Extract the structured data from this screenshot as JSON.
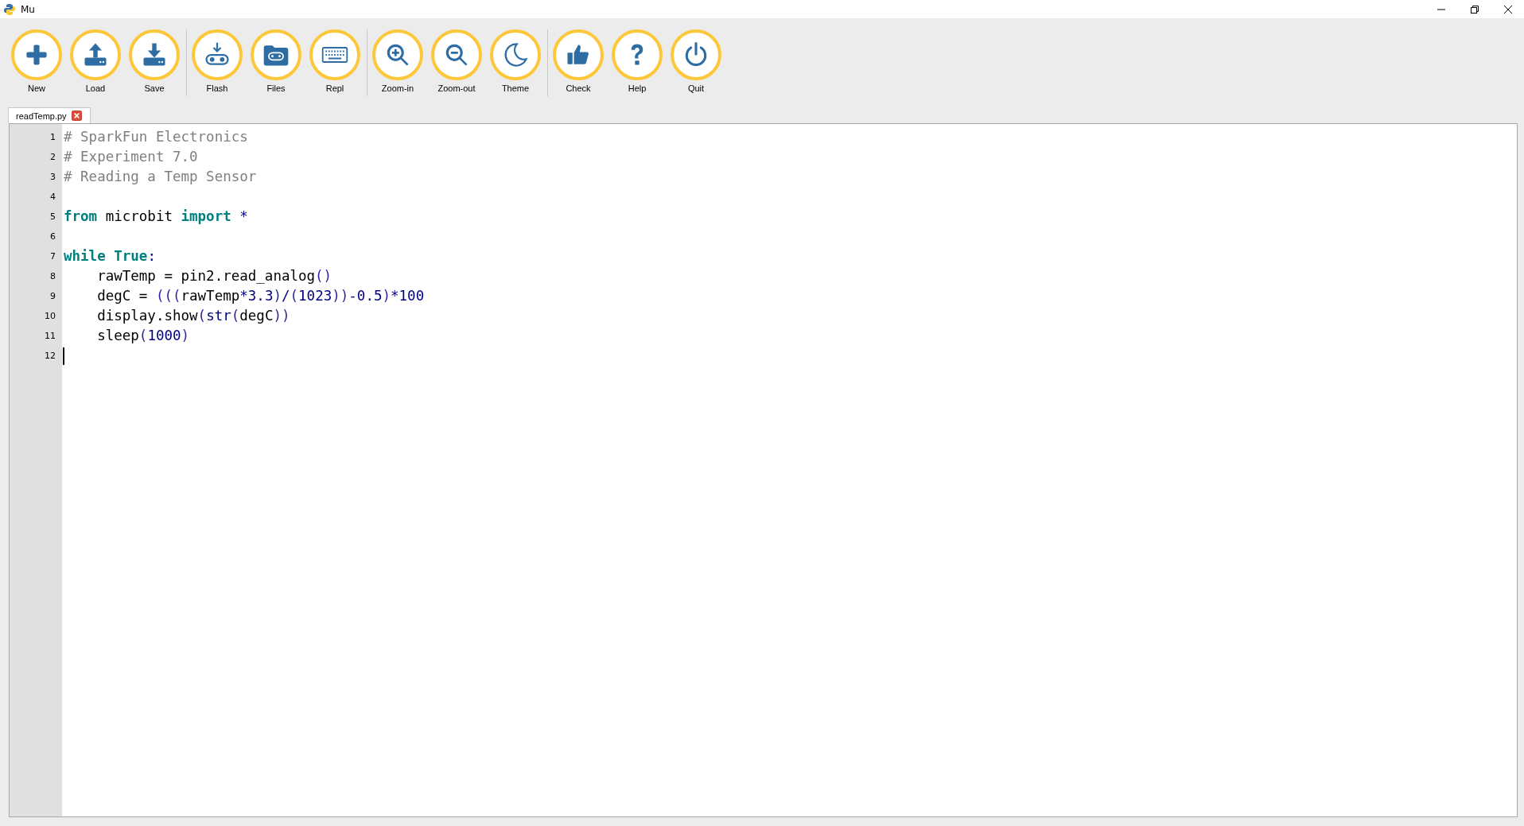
{
  "window": {
    "title": "Mu"
  },
  "toolbar": {
    "groups": [
      [
        {
          "label": "New"
        },
        {
          "label": "Load"
        },
        {
          "label": "Save"
        }
      ],
      [
        {
          "label": "Flash"
        },
        {
          "label": "Files"
        },
        {
          "label": "Repl"
        }
      ],
      [
        {
          "label": "Zoom-in"
        },
        {
          "label": "Zoom-out"
        },
        {
          "label": "Theme"
        }
      ],
      [
        {
          "label": "Check"
        },
        {
          "label": "Help"
        },
        {
          "label": "Quit"
        }
      ]
    ]
  },
  "tabs": [
    {
      "label": "readTemp.py",
      "selected": true
    }
  ],
  "editor": {
    "lines": [
      {
        "number": "1",
        "tokens": [
          {
            "kind": "comment",
            "text": "# SparkFun Electronics"
          }
        ]
      },
      {
        "number": "2",
        "tokens": [
          {
            "kind": "comment",
            "text": "# Experiment 7.0"
          }
        ]
      },
      {
        "number": "3",
        "tokens": [
          {
            "kind": "comment",
            "text": "# Reading a Temp Sensor"
          }
        ]
      },
      {
        "number": "4"
      },
      {
        "number": "5",
        "tokens": [
          {
            "kind": "keyword",
            "text": "from"
          },
          {
            "kind": "name",
            "text": " microbit "
          },
          {
            "kind": "keyword",
            "text": "import"
          },
          {
            "kind": "operator",
            "text": " *"
          }
        ]
      },
      {
        "number": "6"
      },
      {
        "number": "7",
        "tokens": [
          {
            "kind": "keyword",
            "text": "while"
          },
          {
            "kind": "keyword",
            "text": " True"
          },
          {
            "kind": "operator",
            "text": ":"
          }
        ]
      },
      {
        "number": "8",
        "tokens": [
          {
            "kind": "name",
            "text": "    rawTemp = pin2.read_analog"
          },
          {
            "kind": "paren",
            "text": "()"
          }
        ]
      },
      {
        "number": "9",
        "tokens": [
          {
            "kind": "name",
            "text": "    degC = "
          },
          {
            "kind": "paren",
            "text": "((("
          },
          {
            "kind": "name",
            "text": "rawTemp"
          },
          {
            "kind": "operator",
            "text": "*"
          },
          {
            "kind": "number",
            "text": "3.3"
          },
          {
            "kind": "paren",
            "text": ")"
          },
          {
            "kind": "operator",
            "text": "/"
          },
          {
            "kind": "paren",
            "text": "("
          },
          {
            "kind": "number",
            "text": "1023"
          },
          {
            "kind": "paren",
            "text": "))"
          },
          {
            "kind": "operator",
            "text": "-"
          },
          {
            "kind": "number",
            "text": "0.5"
          },
          {
            "kind": "paren",
            "text": ")"
          },
          {
            "kind": "operator",
            "text": "*"
          },
          {
            "kind": "number",
            "text": "100"
          }
        ]
      },
      {
        "number": "10",
        "tokens": [
          {
            "kind": "name",
            "text": "    display.show"
          },
          {
            "kind": "paren",
            "text": "("
          },
          {
            "kind": "number",
            "text": "str"
          },
          {
            "kind": "paren",
            "text": "("
          },
          {
            "kind": "name",
            "text": "degC"
          },
          {
            "kind": "paren",
            "text": "))"
          }
        ]
      },
      {
        "number": "11",
        "tokens": [
          {
            "kind": "name",
            "text": "    sleep"
          },
          {
            "kind": "paren",
            "text": "("
          },
          {
            "kind": "number",
            "text": "1000"
          },
          {
            "kind": "paren",
            "text": ")"
          }
        ]
      },
      {
        "number": "12",
        "cursor": true
      }
    ]
  }
}
